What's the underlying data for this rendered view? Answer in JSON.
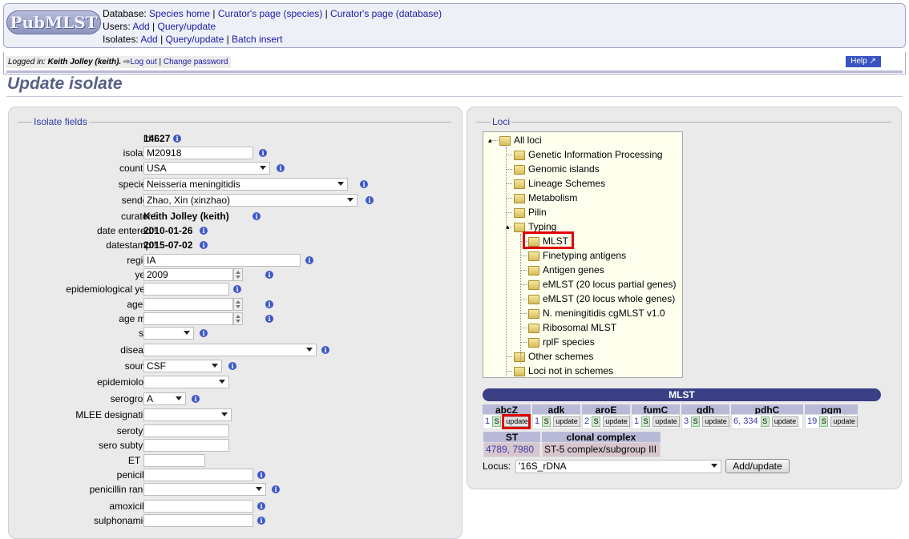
{
  "header": {
    "logo": "PubMLST",
    "database_label": "Database:",
    "database_links": [
      "Species home",
      "Curator's page (species)",
      "Curator's page (database)"
    ],
    "users_label": "Users:",
    "users_links": [
      "Add",
      "Query/update"
    ],
    "isolates_label": "Isolates:",
    "isolates_links": [
      "Add",
      "Query/update",
      "Batch insert"
    ]
  },
  "userbar": {
    "logged_in_label": "Logged in:",
    "user": "Keith Jolley (keith).",
    "logout": "Log out",
    "change_password": "Change password",
    "help": "Help"
  },
  "page_title": "Update isolate",
  "isolate_fields": {
    "legend": "Isolate fields",
    "rows": [
      {
        "label": "id:!",
        "kind": "static",
        "value": "14627"
      },
      {
        "label": "isolate:!",
        "kind": "text",
        "value": "M20918"
      },
      {
        "label": "country:!",
        "kind": "select",
        "value": "USA"
      },
      {
        "label": "species:!",
        "kind": "select",
        "value": "Neisseria meningitidis"
      },
      {
        "label": "sender:!",
        "kind": "select",
        "value": "Zhao, Xin (xinzhao)"
      },
      {
        "label": "curator:!",
        "kind": "static",
        "value": "Keith Jolley (keith)"
      },
      {
        "label": "date entered:!",
        "kind": "static",
        "value": "2010-01-26"
      },
      {
        "label": "datestamp:!",
        "kind": "static",
        "value": "2015-07-02"
      },
      {
        "label": "region:",
        "kind": "text",
        "value": "IA"
      },
      {
        "label": "year:",
        "kind": "spin",
        "value": "2009"
      },
      {
        "label": "epidemiological year:",
        "kind": "text",
        "value": ""
      },
      {
        "label": "age yr:",
        "kind": "spin",
        "value": ""
      },
      {
        "label": "age mth:",
        "kind": "spin",
        "value": ""
      },
      {
        "label": "sex:",
        "kind": "select",
        "value": ""
      },
      {
        "label": "disease:",
        "kind": "select",
        "value": ""
      },
      {
        "label": "source:",
        "kind": "select",
        "value": "CSF"
      },
      {
        "label": "epidemiology:",
        "kind": "select",
        "value": ""
      },
      {
        "label": "serogroup:",
        "kind": "select",
        "value": "A"
      },
      {
        "label": "MLEE designation:",
        "kind": "select",
        "value": ""
      },
      {
        "label": "serotype:",
        "kind": "text",
        "value": ""
      },
      {
        "label": "sero subtype:",
        "kind": "text",
        "value": ""
      },
      {
        "label": "ET no:",
        "kind": "text",
        "value": ""
      },
      {
        "label": "penicillin:",
        "kind": "text",
        "value": ""
      },
      {
        "label": "penicillin range:",
        "kind": "select",
        "value": ""
      },
      {
        "label": "amoxicillin:",
        "kind": "text",
        "value": ""
      },
      {
        "label": "sulphonamide:",
        "kind": "text",
        "value": ""
      }
    ]
  },
  "loci": {
    "legend": "Loci",
    "tree": [
      {
        "label": "All loci",
        "depth": 0
      },
      {
        "label": "Genetic Information Processing",
        "depth": 1
      },
      {
        "label": "Genomic islands",
        "depth": 1
      },
      {
        "label": "Lineage Schemes",
        "depth": 1
      },
      {
        "label": "Metabolism",
        "depth": 1
      },
      {
        "label": "Pilin",
        "depth": 1
      },
      {
        "label": "Typing",
        "depth": 1
      },
      {
        "label": "MLST",
        "depth": 2
      },
      {
        "label": "Finetyping antigens",
        "depth": 2
      },
      {
        "label": "Antigen genes",
        "depth": 2
      },
      {
        "label": "eMLST (20 locus partial genes)",
        "depth": 2
      },
      {
        "label": "eMLST (20 locus whole genes)",
        "depth": 2
      },
      {
        "label": "N. meningitidis cgMLST v1.0",
        "depth": 2
      },
      {
        "label": "Ribosomal MLST",
        "depth": 2
      },
      {
        "label": "rplF species",
        "depth": 2
      },
      {
        "label": "Other schemes",
        "depth": 1
      },
      {
        "label": "Loci not in schemes",
        "depth": 1
      }
    ]
  },
  "mlst": {
    "title": "MLST",
    "loci": [
      {
        "name": "abcZ",
        "value": "1"
      },
      {
        "name": "adk",
        "value": "1"
      },
      {
        "name": "aroE",
        "value": "2"
      },
      {
        "name": "fumC",
        "value": "1"
      },
      {
        "name": "gdh",
        "value": "3"
      },
      {
        "name": "pdhC",
        "value": "6, 334"
      },
      {
        "name": "pgm",
        "value": "19"
      }
    ],
    "s_label": "S",
    "update_label": "update",
    "st_header": "ST",
    "cc_header": "clonal complex",
    "st_value": "4789, 7980",
    "cc_value": "ST-5 complex/subgroup III"
  },
  "locus_select": {
    "label": "Locus:",
    "value": "'16S_rDNA",
    "button": "Add/update"
  }
}
